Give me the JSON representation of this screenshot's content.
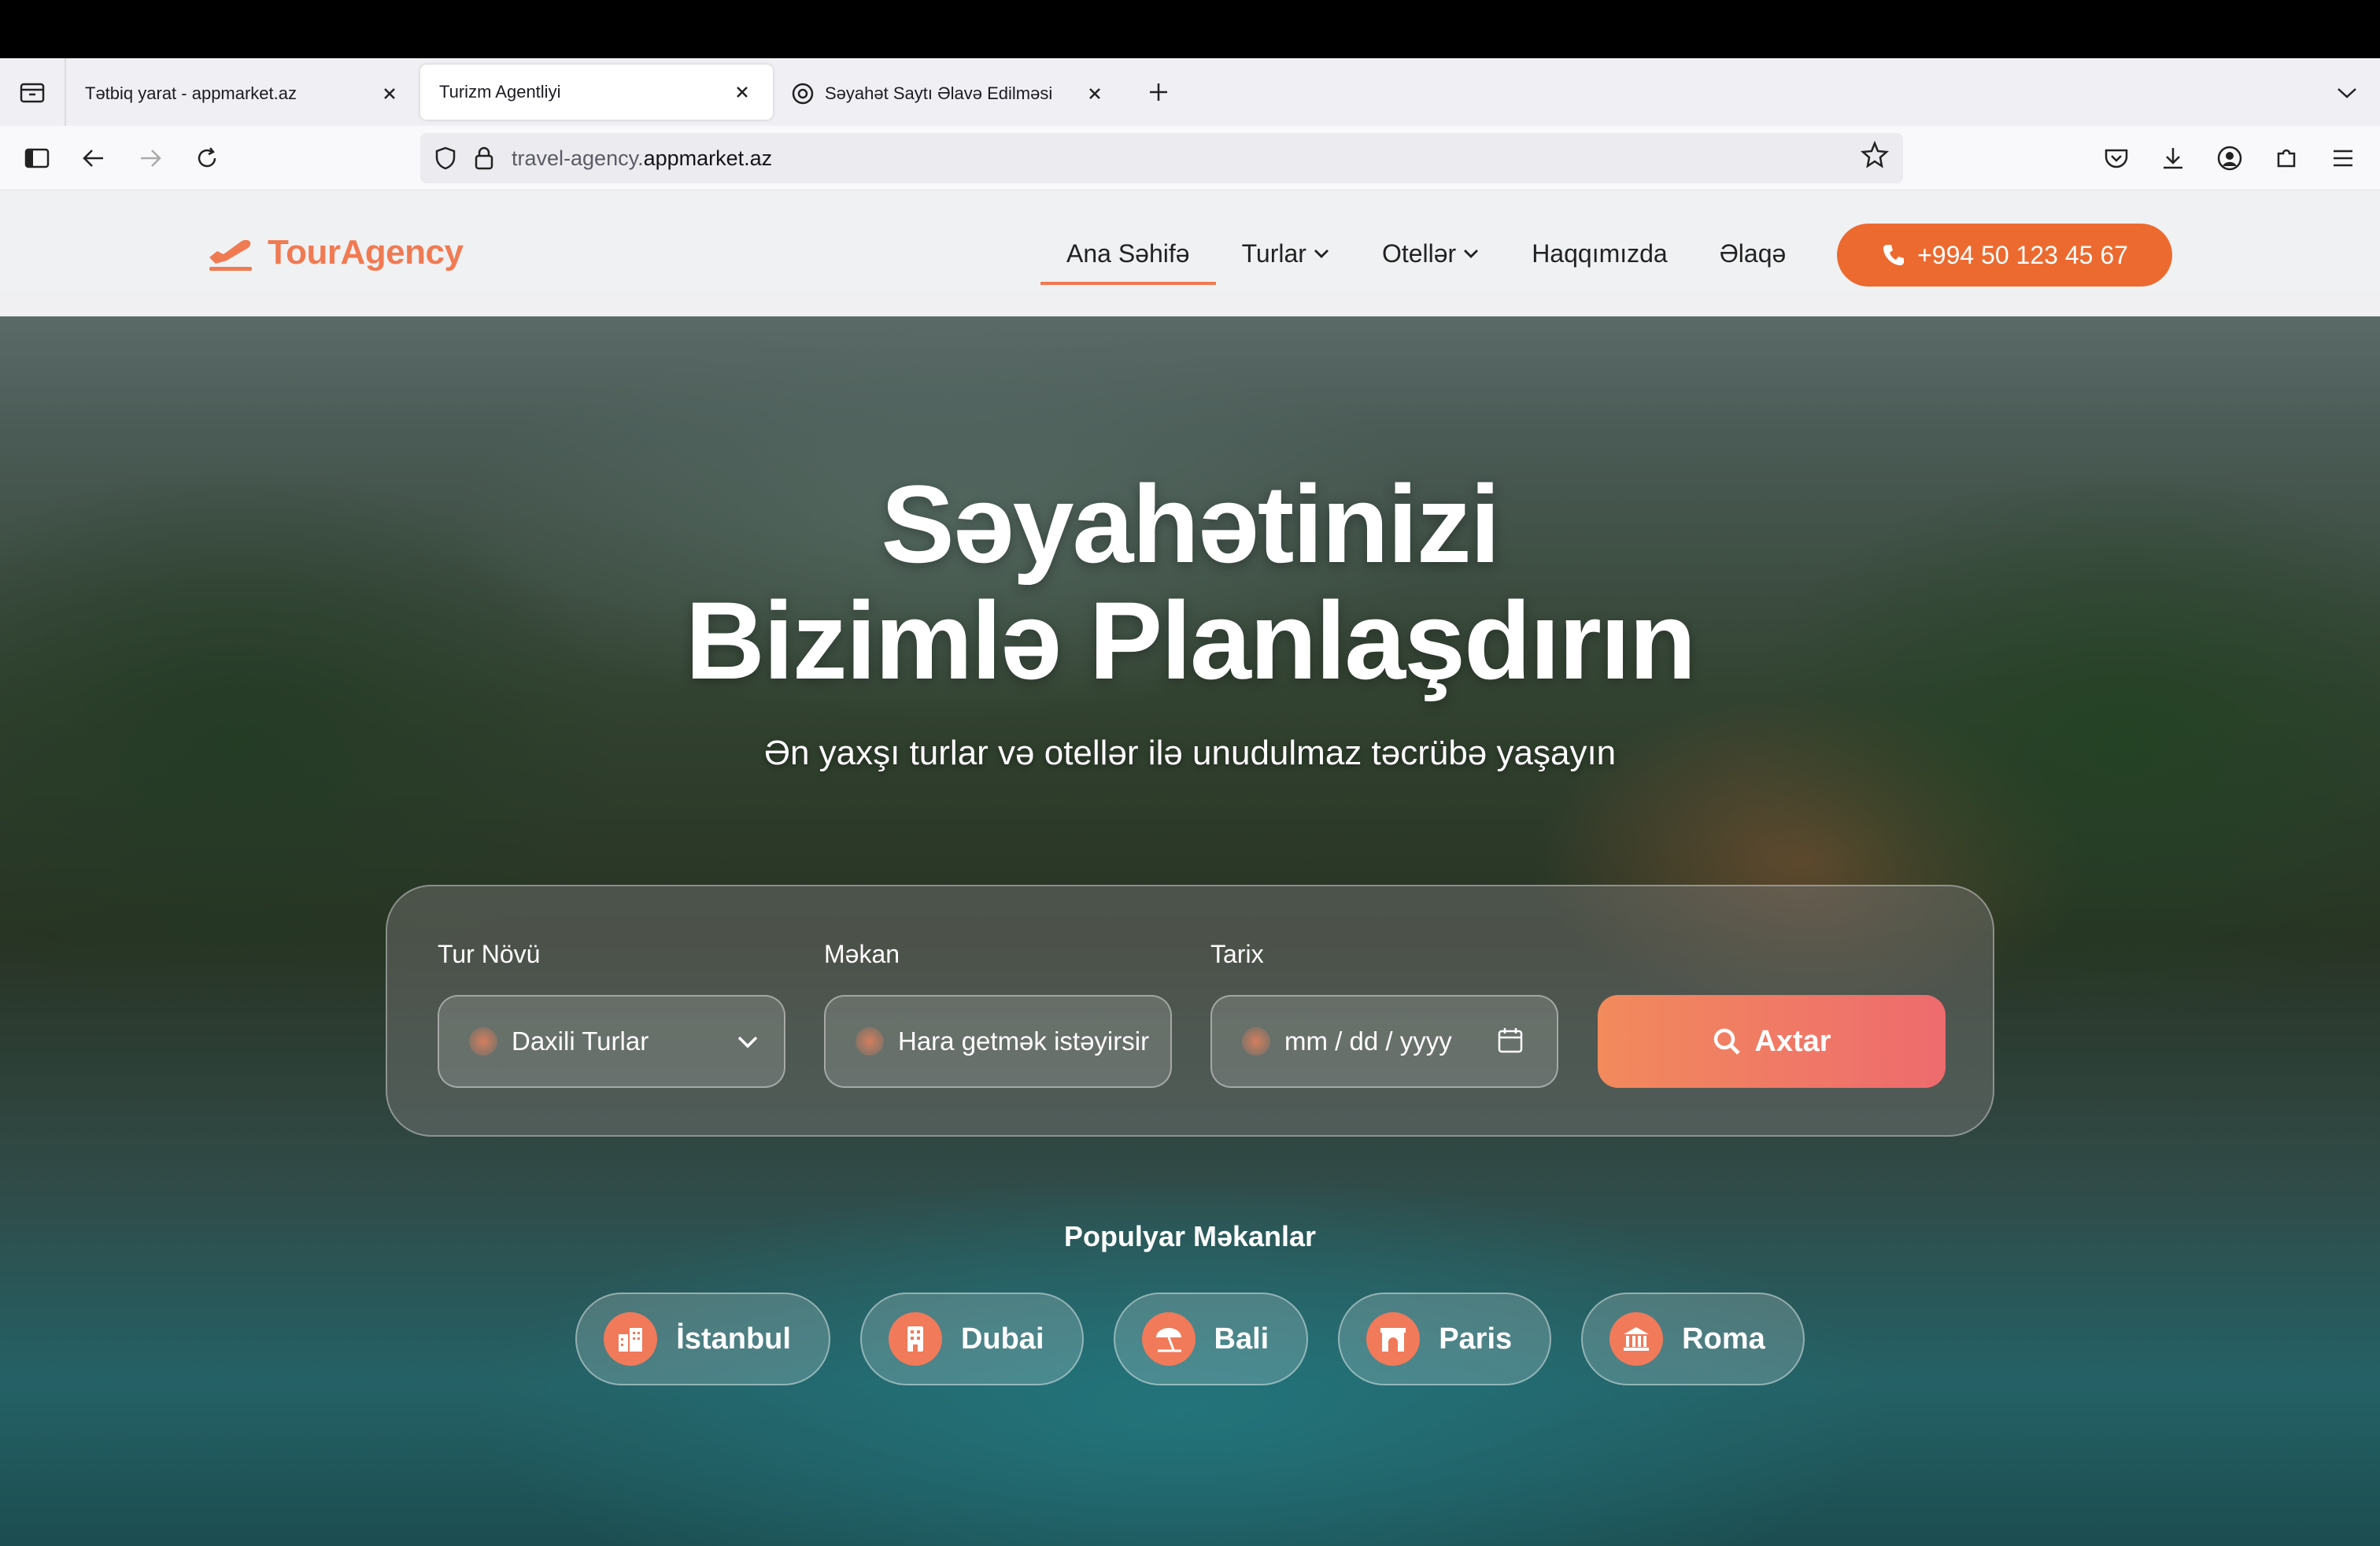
{
  "browser": {
    "tabs": [
      {
        "title": "Tətbiq yarat - appmarket.az"
      },
      {
        "title": "Turizm Agentliyi"
      },
      {
        "title": "Səyahət Saytı Əlavə Edilməsi"
      }
    ],
    "url_prefix": "travel-agency.",
    "url_domain": "appmarket.az"
  },
  "site": {
    "logo": "TourAgency",
    "menu": {
      "home": "Ana Səhifə",
      "tours": "Turlar",
      "hotels": "Otellər",
      "about": "Haqqımızda",
      "contact": "Əlaqə"
    },
    "phone": "+994 50 123 45 67",
    "accent_color": "#f07a52"
  },
  "hero": {
    "title_line1": "Səyahətinizi",
    "title_line2": "Bizimlə Planlaşdırın",
    "subtitle": "Ən yaxşı turlar və otellər ilə unudulmaz təcrübə yaşayın"
  },
  "search": {
    "tour_type_label": "Tur Növü",
    "tour_type_value": "Daxili Turlar",
    "location_label": "Məkan",
    "location_placeholder": "Hara getmək istəyirsir",
    "date_label": "Tarix",
    "date_placeholder": "mm / dd / yyyy",
    "button": "Axtar"
  },
  "popular": {
    "title": "Populyar Məkanlar",
    "places": [
      {
        "name": "İstanbul",
        "icon": "city-icon"
      },
      {
        "name": "Dubai",
        "icon": "building-icon"
      },
      {
        "name": "Bali",
        "icon": "beach-umbrella-icon"
      },
      {
        "name": "Paris",
        "icon": "arch-icon"
      },
      {
        "name": "Roma",
        "icon": "landmark-icon"
      }
    ]
  }
}
